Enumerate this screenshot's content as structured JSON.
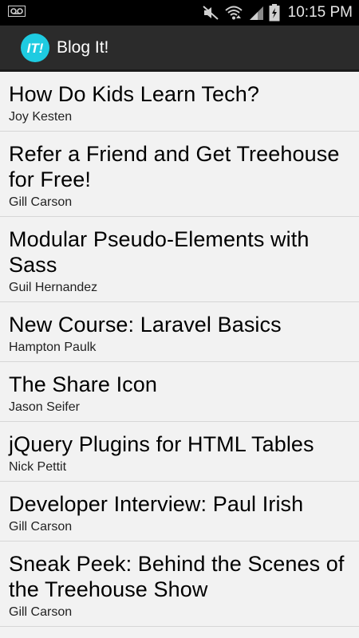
{
  "status_bar": {
    "time": "10:15 PM",
    "icons": [
      "voicemail-icon",
      "mute-icon",
      "wifi-icon",
      "signal-icon",
      "battery-charging-icon"
    ]
  },
  "action_bar": {
    "icon_text": "IT!",
    "title": "Blog It!",
    "accent_color": "#1ecbe1"
  },
  "posts": [
    {
      "title": "How Do Kids Learn Tech?",
      "author": "Joy Kesten"
    },
    {
      "title": "Refer a Friend and Get Treehouse for Free!",
      "author": "Gill Carson"
    },
    {
      "title": "Modular Pseudo-Elements with Sass",
      "author": "Guil Hernandez"
    },
    {
      "title": "New Course: Laravel Basics",
      "author": "Hampton Paulk"
    },
    {
      "title": "The Share Icon",
      "author": "Jason Seifer"
    },
    {
      "title": "jQuery Plugins for HTML Tables",
      "author": "Nick Pettit"
    },
    {
      "title": "Developer Interview: Paul Irish",
      "author": "Gill Carson"
    },
    {
      "title": "Sneak Peek: Behind the Scenes of the Treehouse Show",
      "author": "Gill Carson"
    }
  ]
}
